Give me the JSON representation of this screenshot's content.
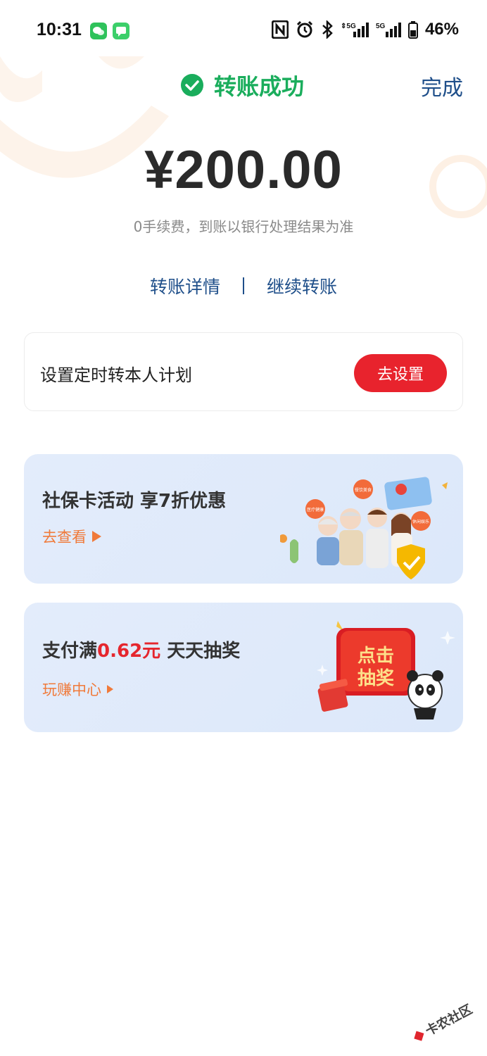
{
  "status_bar": {
    "time": "10:31",
    "battery": "46%",
    "icons": [
      "wechat-icon",
      "message-icon",
      "nfc-icon",
      "alarm-icon",
      "bluetooth-icon",
      "signal-5g-icon",
      "signal-5g-icon",
      "battery-icon"
    ]
  },
  "header": {
    "title": "转账成功",
    "done_label": "完成"
  },
  "amount": "¥200.00",
  "fee_note": "0手续费，到账以银行处理结果为准",
  "links": {
    "detail": "转账详情",
    "continue": "继续转账"
  },
  "schedule": {
    "label": "设置定时转本人计划",
    "button": "去设置"
  },
  "promo1": {
    "title": "社保卡活动 享7折优惠",
    "link": "去查看",
    "bubbles": [
      "医疗健康",
      "餐饮美食",
      "休闲娱乐"
    ]
  },
  "promo2": {
    "title_prefix": "支付满",
    "title_highlight": "0.62元",
    "title_suffix": " 天天抽奖",
    "link": "玩赚中心",
    "badge_line1": "点击",
    "badge_line2": "抽奖"
  },
  "watermark": "卡农社区",
  "colors": {
    "success": "#1aad5c",
    "link": "#1f4f8a",
    "primary_red": "#e8232d",
    "promo_orange": "#f07a3a"
  }
}
